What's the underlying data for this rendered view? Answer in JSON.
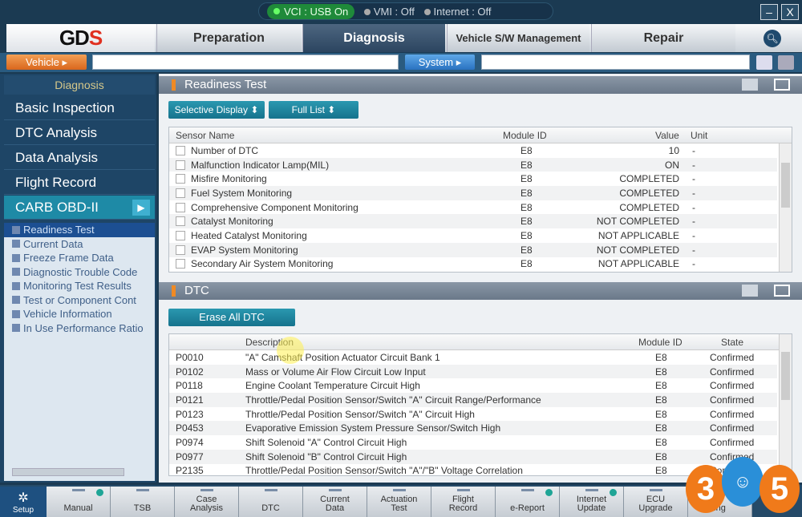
{
  "status": {
    "vci": "VCI : USB On",
    "vmi": "VMI : Off",
    "internet": "Internet : Off"
  },
  "window": {
    "minimize": "–",
    "close": "X"
  },
  "logo": "GDS",
  "tabs": [
    {
      "label": "Preparation"
    },
    {
      "label": "Diagnosis",
      "selected": true
    },
    {
      "label": "Vehicle S/W Management"
    },
    {
      "label": "Repair"
    }
  ],
  "vehicle_button": "Vehicle ▸",
  "vehicle_value": "",
  "system_button": "System ▸",
  "system_value": "",
  "sidebar": {
    "header": "Diagnosis",
    "items": [
      {
        "label": "Basic Inspection"
      },
      {
        "label": "DTC Analysis"
      },
      {
        "label": "Data Analysis"
      },
      {
        "label": "Flight Record"
      },
      {
        "label": "CARB OBD-II",
        "selected": true
      }
    ],
    "subitems": [
      "Readiness Test",
      "Current Data",
      "Freeze Frame Data",
      "Diagnostic Trouble Code",
      "Monitoring Test Results",
      "Test or Component Cont",
      "Vehicle Information",
      "In Use Performance Ratio"
    ]
  },
  "readiness": {
    "title": "Readiness Test",
    "selective_display": "Selective Display ⬍",
    "full_list": "Full List ⬍",
    "headers": {
      "name": "Sensor Name",
      "module": "Module ID",
      "value": "Value",
      "unit": "Unit"
    },
    "rows": [
      {
        "name": "Number of DTC",
        "module": "E8",
        "value": "10",
        "unit": "-"
      },
      {
        "name": "Malfunction Indicator Lamp(MIL)",
        "module": "E8",
        "value": "ON",
        "unit": "-"
      },
      {
        "name": "Misfire Monitoring",
        "module": "E8",
        "value": "COMPLETED",
        "unit": "-"
      },
      {
        "name": "Fuel System Monitoring",
        "module": "E8",
        "value": "COMPLETED",
        "unit": "-"
      },
      {
        "name": "Comprehensive Component Monitoring",
        "module": "E8",
        "value": "COMPLETED",
        "unit": "-"
      },
      {
        "name": "Catalyst Monitoring",
        "module": "E8",
        "value": "NOT COMPLETED",
        "unit": "-"
      },
      {
        "name": "Heated Catalyst Monitoring",
        "module": "E8",
        "value": "NOT APPLICABLE",
        "unit": "-"
      },
      {
        "name": "EVAP System Monitoring",
        "module": "E8",
        "value": "NOT COMPLETED",
        "unit": "-"
      },
      {
        "name": "Secondary Air System Monitoring",
        "module": "E8",
        "value": "NOT APPLICABLE",
        "unit": "-"
      }
    ]
  },
  "dtc": {
    "title": "DTC",
    "erase": "Erase All DTC",
    "headers": {
      "description": "Description",
      "module": "Module ID",
      "state": "State"
    },
    "rows": [
      {
        "code": "P0010",
        "description": "\"A\" Camshaft Position Actuator Circuit Bank 1",
        "module": "E8",
        "state": "Confirmed"
      },
      {
        "code": "P0102",
        "description": "Mass or Volume Air Flow Circuit Low Input",
        "module": "E8",
        "state": "Confirmed"
      },
      {
        "code": "P0118",
        "description": "Engine Coolant Temperature Circuit High",
        "module": "E8",
        "state": "Confirmed"
      },
      {
        "code": "P0121",
        "description": "Throttle/Pedal Position Sensor/Switch \"A\" Circuit Range/Performance",
        "module": "E8",
        "state": "Confirmed"
      },
      {
        "code": "P0123",
        "description": "Throttle/Pedal Position Sensor/Switch \"A\" Circuit High",
        "module": "E8",
        "state": "Confirmed"
      },
      {
        "code": "P0453",
        "description": "Evaporative Emission System Pressure Sensor/Switch High",
        "module": "E8",
        "state": "Confirmed"
      },
      {
        "code": "P0974",
        "description": "Shift Solenoid \"A\" Control Circuit High",
        "module": "E8",
        "state": "Confirmed"
      },
      {
        "code": "P0977",
        "description": "Shift Solenoid \"B\" Control Circuit High",
        "module": "E8",
        "state": "Confirmed"
      },
      {
        "code": "P2135",
        "description": "Throttle/Pedal Position Sensor/Switch \"A\"/\"B\" Voltage Correlation",
        "module": "E8",
        "state": "Confirmed"
      }
    ]
  },
  "bottom": {
    "setup": "Setup",
    "buttons": [
      "Manual",
      "TSB",
      "Case Analysis",
      "DTC",
      "Current Data",
      "Actuation Test",
      "Flight Record",
      "e-Report",
      "Internet Update",
      "ECU Upgrade",
      "ing"
    ]
  },
  "watermark": "365",
  "colors": {
    "accent": "#1e8aa6",
    "vehicle": "#e07a2c",
    "system": "#2a72c0",
    "selected_tab": "#2c4560"
  }
}
